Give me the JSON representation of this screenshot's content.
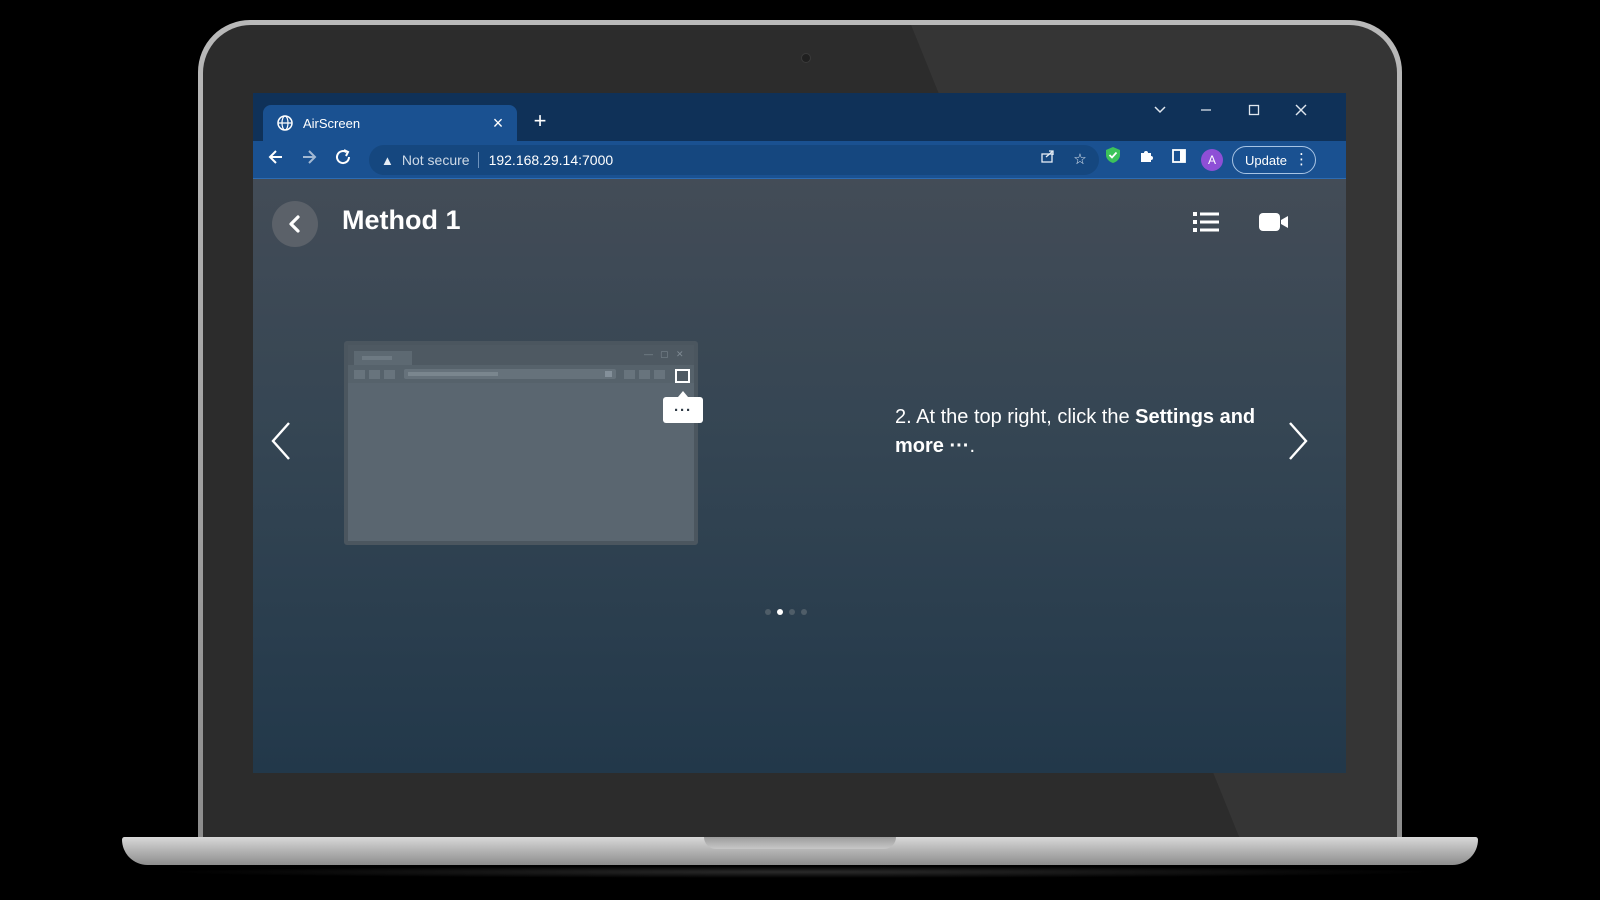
{
  "browser": {
    "tab_title": "AirScreen",
    "new_tab_label": "+",
    "security_label": "Not secure",
    "url": "192.168.29.14:7000",
    "update_label": "Update",
    "profile_initial": "A",
    "accent_color": "#1a5191",
    "tabstrip_color": "#0f3158"
  },
  "page": {
    "title": "Method 1",
    "instruction": {
      "prefix": "2. At the top right, click the ",
      "bold": "Settings and more",
      "suffix_icon": " ···",
      "end": "."
    },
    "illustration_menu_label": "···",
    "carousel": {
      "slide_count": 4,
      "active_index": 1
    }
  },
  "icons": {
    "back": "chevron-left-icon",
    "list": "list-icon",
    "video": "video-camera-icon",
    "prev": "chevron-left-thin-icon",
    "next": "chevron-right-thin-icon"
  }
}
